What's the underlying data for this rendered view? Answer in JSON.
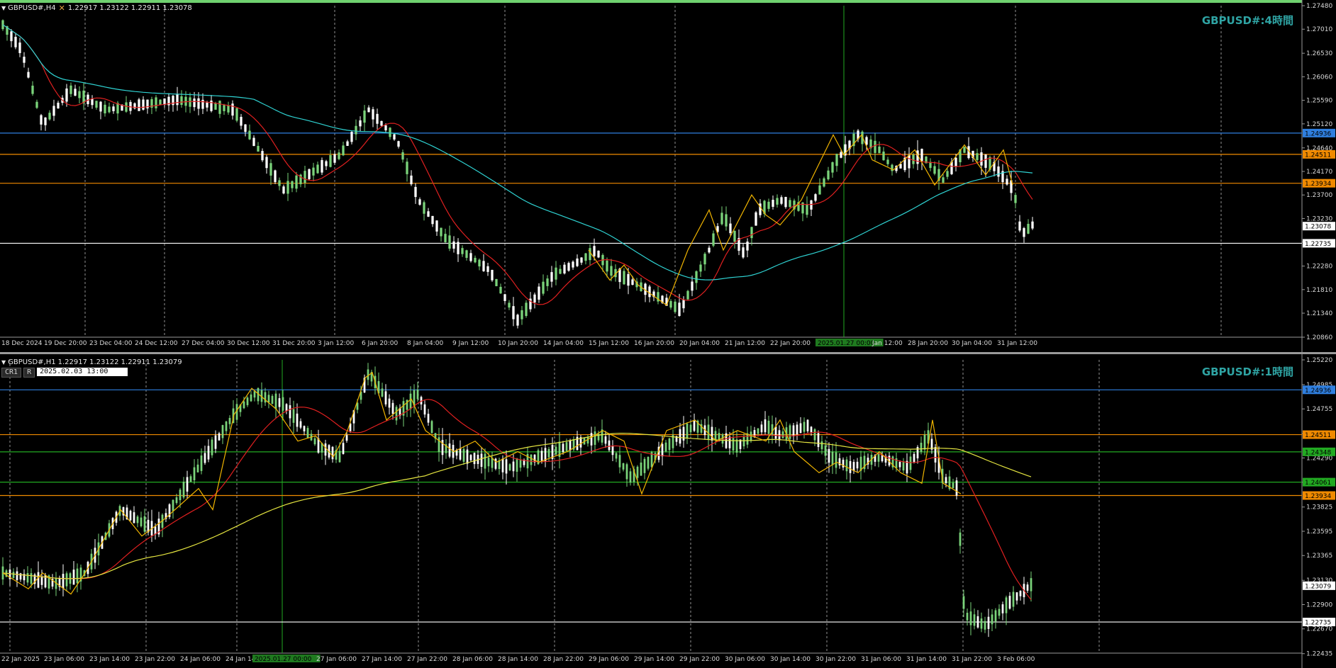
{
  "colors": {
    "bg": "#000000",
    "grid": "#d0d0d0",
    "axis_text": "#d8d8d8",
    "bull": "#7ad37a",
    "bear": "#ffffff",
    "ma_fast": "#e02020",
    "ma_slow_h4": "#2fd3d3",
    "ma_slow_h1": "#e6e640",
    "zigzag": "#f0b400",
    "line_blue": "#2f7fdf",
    "line_orange": "#f08a00",
    "line_white": "#ffffff",
    "line_green": "#22aa22",
    "title": "#2fa4a4"
  },
  "icons": [
    "collapse-arrow-icon",
    "crosshair-cursor-icon"
  ],
  "h4": {
    "header": "GBPUSD#,H4  1.22917 1.23122 1.22911 1.23078",
    "header_symbol": "GBPUSD#,H4",
    "header_prices": "1.22917 1.23122 1.22911 1.23078",
    "title": "GBPUSD#:4時間",
    "price_top": 1.2748,
    "price_bottom": 1.2086,
    "price_ticks": [
      "1.27480",
      "1.27010",
      "1.26530",
      "1.26060",
      "1.25590",
      "1.25120",
      "1.24640",
      "1.24170",
      "1.23700",
      "1.23230",
      "1.22760",
      "1.22280",
      "1.21810",
      "1.21340",
      "1.20860"
    ],
    "levels": [
      {
        "price": 1.24936,
        "label": "1.24936",
        "color": "#2f7fdf"
      },
      {
        "price": 1.24511,
        "label": "1.24511",
        "color": "#f08a00"
      },
      {
        "price": 1.23934,
        "label": "1.23934",
        "color": "#f08a00"
      },
      {
        "price": 1.22735,
        "label": "1.22735",
        "color": "#ffffff"
      }
    ],
    "current_price": {
      "price": 1.23078,
      "label": "1.23078"
    },
    "time_labels": [
      "18 Dec 2024",
      "19 Dec 20:00",
      "23 Dec 04:00",
      "24 Dec 12:00",
      "27 Dec 04:00",
      "30 Dec 12:00",
      "31 Dec 20:00",
      "3 Jan 12:00",
      "6 Jan 20:00",
      "8 Jan 04:00",
      "9 Jan 12:00",
      "10 Jan 20:00",
      "14 Jan 04:00",
      "15 Jan 12:00",
      "16 Jan 20:00",
      "20 Jan 04:00",
      "21 Jan 12:00",
      "22 Jan 20:00",
      "2025.01.27 00:00",
      "Jan 12:00",
      "28 Jan 20:00",
      "30 Jan 04:00",
      "31 Jan 12:00"
    ],
    "vline_date": "2025.01.27 00:00"
  },
  "h1": {
    "header": "GBPUSD#,H1  1.22917 1.23122 1.22911 1.23079",
    "header_symbol": "GBPUSD#,H1",
    "header_prices": "1.22917 1.23122 1.22911 1.23079",
    "title": "GBPUSD#:1時間",
    "controls": {
      "cr1": "CR1",
      "r": "R",
      "datetime": "2025.02.03 13:00"
    },
    "price_top": 1.2522,
    "price_bottom": 1.2244,
    "price_ticks": [
      "1.25220",
      "1.24985",
      "1.24755",
      "1.24520",
      "1.24290",
      "1.24060",
      "1.23825",
      "1.23595",
      "1.23365",
      "1.23130",
      "1.22900",
      "1.22670",
      "1.22435"
    ],
    "levels": [
      {
        "price": 1.24936,
        "label": "1.24936",
        "color": "#2f7fdf"
      },
      {
        "price": 1.24511,
        "label": "1.24511",
        "color": "#f08a00"
      },
      {
        "price": 1.24348,
        "label": "1.24348",
        "color": "#22aa22"
      },
      {
        "price": 1.24061,
        "label": "1.24061",
        "color": "#22aa22"
      },
      {
        "price": 1.23934,
        "label": "1.23934",
        "color": "#f08a00"
      },
      {
        "price": 1.22735,
        "label": "1.22735",
        "color": "#ffffff"
      }
    ],
    "current_price": {
      "price": 1.23079,
      "label": "1.23079"
    },
    "time_labels": [
      "22 Jan 2025",
      "23 Jan 06:00",
      "23 Jan 14:00",
      "23 Jan 22:00",
      "24 Jan 06:00",
      "24 Jan 14",
      "2025.01.27 00:00",
      "27 Jan 06:00",
      "27 Jan 14:00",
      "27 Jan 22:00",
      "28 Jan 06:00",
      "28 Jan 14:00",
      "28 Jan 22:00",
      "29 Jan 06:00",
      "29 Jan 14:00",
      "29 Jan 22:00",
      "30 Jan 06:00",
      "30 Jan 14:00",
      "30 Jan 22:00",
      "31 Jan 06:00",
      "31 Jan 14:00",
      "31 Jan 22:00",
      "3 Feb 06:00"
    ],
    "vline_date": "2025.01.27 00:00"
  }
}
